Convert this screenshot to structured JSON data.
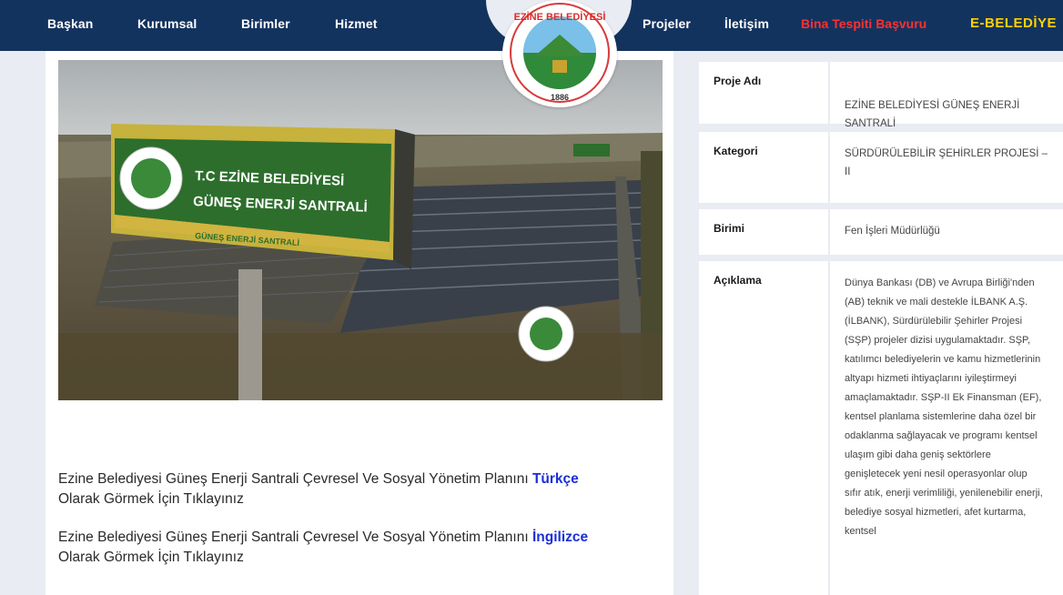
{
  "nav": {
    "left_items": [
      "Başkan",
      "Kurumsal",
      "Birimler",
      "Hizmet"
    ],
    "right_items": [
      "Projeler",
      "İletişim"
    ],
    "special_link": "Bina Tespiti Başvuru",
    "ebelediye_label": "E-BELEDİYE"
  },
  "logo": {
    "top_text": "EZİNE BELEDİYESİ",
    "year": "1886"
  },
  "hero": {
    "billboard_line1": "T.C EZİNE BELEDİYESİ",
    "billboard_line2": "GÜNEŞ ENERJİ SANTRALİ",
    "billboard_strip": "GÜNEŞ ENERJİ SANTRALİ"
  },
  "links": [
    {
      "text": "Ezine Belediyesi Güneş Enerji Santrali Çevresel Ve Sosyal Yönetim Planını ",
      "link": "Türkçe",
      "tail": "Olarak Görmek İçin Tıklayınız"
    },
    {
      "text": "Ezine Belediyesi Güneş Enerji Santrali Çevresel Ve Sosyal Yönetim Planını ",
      "link": "İngilizce",
      "tail": "Olarak Görmek İçin Tıklayınız"
    }
  ],
  "details": [
    {
      "label": "Proje Adı",
      "value": "EZİNE BELEDİYESİ GÜNEŞ ENERJİ SANTRALİ"
    },
    {
      "label": "Kategori",
      "value": "SÜRDÜRÜLEBİLİR ŞEHİRLER PROJESİ – II"
    },
    {
      "label": "Birimi",
      "value": "Fen İşleri Müdürlüğü"
    },
    {
      "label": "Açıklama",
      "value": "Dünya Bankası (DB) ve Avrupa Birliği'nden (AB) teknik ve mali destekle İLBANK A.Ş. (İLBANK), Sürdürülebilir Şehirler Projesi (SŞP) projeler dizisi uygulamaktadır. SŞP, katılımcı belediyelerin ve kamu hizmetlerinin altyapı hizmeti ihtiyaçlarını iyileştirmeyi amaçlamaktadır. SŞP-II Ek Finansman (EF), kentsel planlama sistemlerine daha özel bir odaklanma sağlayacak ve programı kentsel ulaşım gibi daha geniş sektörlere genişletecek yeni nesil operasyonlar olup sıfır atık, enerji verimliliği, yenilenebilir enerji, belediye sosyal hizmetleri, afet kurtarma, kentsel"
    }
  ],
  "colors": {
    "nav_bg": "#13335f",
    "link": "#1b2fd6",
    "special": "#ff3030",
    "ebelediye": "#ffd000"
  }
}
